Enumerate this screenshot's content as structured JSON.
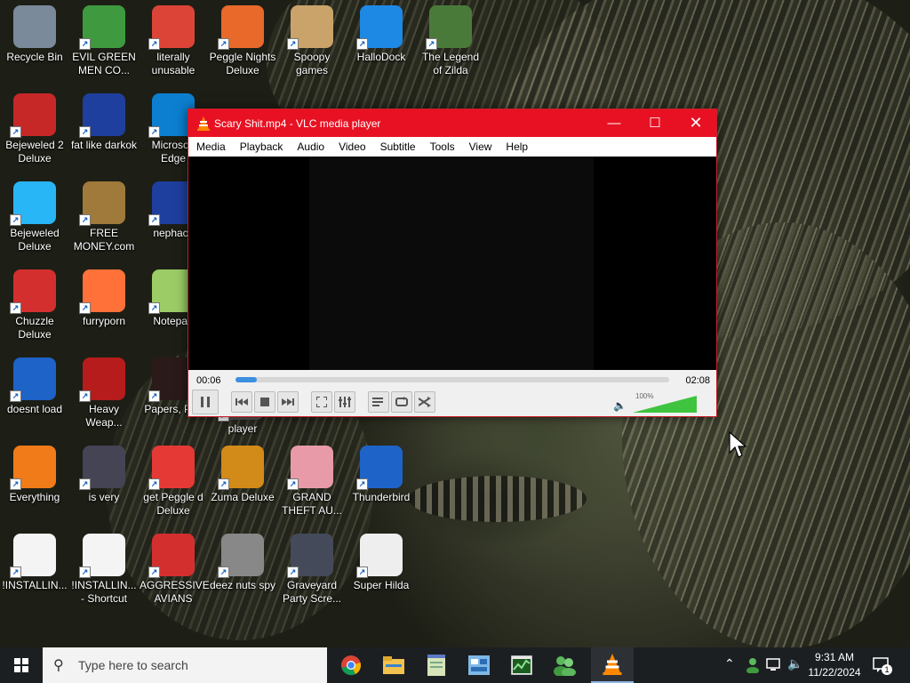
{
  "desktop_icons": [
    {
      "label": "Recycle Bin",
      "icon": "recycle-bin-icon"
    },
    {
      "label": "EVIL GREEN MEN CO...",
      "icon": "messenger-people-icon"
    },
    {
      "label": "literally unusable",
      "icon": "chrome-icon"
    },
    {
      "label": "Peggle Nights Deluxe",
      "icon": "peggle-icon"
    },
    {
      "label": "Spoopy games",
      "icon": "folder-icon"
    },
    {
      "label": "HalloDock",
      "icon": "windows-shield-icon"
    },
    {
      "label": "The Legend of Zilda",
      "icon": "game-character-icon"
    },
    {
      "label": "Bejeweled 2 Deluxe",
      "icon": "bejeweled2-icon"
    },
    {
      "label": "fat like darkok",
      "icon": "mpl-icon"
    },
    {
      "label": "Microsoft Edge",
      "icon": "edge-icon"
    },
    {
      "label": "Bejeweled Deluxe",
      "icon": "diamond-icon"
    },
    {
      "label": "FREE MONEY.com",
      "icon": "money-bag-icon"
    },
    {
      "label": "nephack",
      "icon": "mpl-icon"
    },
    {
      "label": "Chuzzle Deluxe",
      "icon": "chuzzle-icon"
    },
    {
      "label": "furryporn",
      "icon": "firefox-icon"
    },
    {
      "label": "Notepad",
      "icon": "notepad-icon"
    },
    {
      "label": "doesnt load",
      "icon": "thunderbird-icon"
    },
    {
      "label": "Heavy Weap...",
      "icon": "radiation-icon"
    },
    {
      "label": "Papers, Pl...",
      "icon": "papers-please-icon"
    },
    {
      "label": "player",
      "icon": "media-player-icon"
    },
    {
      "label": "Everything",
      "icon": "everything-search-icon"
    },
    {
      "label": "is very",
      "icon": "mpl-shield-icon"
    },
    {
      "label": "get Peggle d Deluxe",
      "icon": "peggle-icon"
    },
    {
      "label": "Zuma Deluxe",
      "icon": "zuma-icon"
    },
    {
      "label": "GRAND THEFT AU...",
      "icon": "anime-girl-icon"
    },
    {
      "label": "Thunderbird",
      "icon": "thunderbird-icon"
    },
    {
      "label": "!INSTALLIN...",
      "icon": "text-file-icon"
    },
    {
      "label": "!INSTALLIN... - Shortcut",
      "icon": "text-file-icon"
    },
    {
      "label": "AGGRESSIVE AVIANS",
      "icon": "angry-bird-icon"
    },
    {
      "label": "deez nuts spy",
      "icon": "windows-stack-icon"
    },
    {
      "label": "Graveyard Party Scre...",
      "icon": "graveyard-icon"
    },
    {
      "label": "Super Hilda",
      "icon": "pixel-dog-icon"
    }
  ],
  "vlc": {
    "title": "Scary Shit.mp4 - VLC media player",
    "menu": [
      "Media",
      "Playback",
      "Audio",
      "Video",
      "Subtitle",
      "Tools",
      "View",
      "Help"
    ],
    "elapsed": "00:06",
    "total": "02:08",
    "progress": 0.05,
    "volume_label": "100%",
    "volume": 1.0,
    "accent": "#e81123"
  },
  "taskbar": {
    "search_placeholder": "Type here to search",
    "apps": [
      "chrome-icon",
      "file-explorer-icon",
      "notepad-icon",
      "control-panel-icon",
      "task-manager-icon",
      "messenger-people-icon",
      "vlc-icon"
    ],
    "time": "9:31 AM",
    "date": "11/22/2024",
    "notification_count": "1"
  }
}
